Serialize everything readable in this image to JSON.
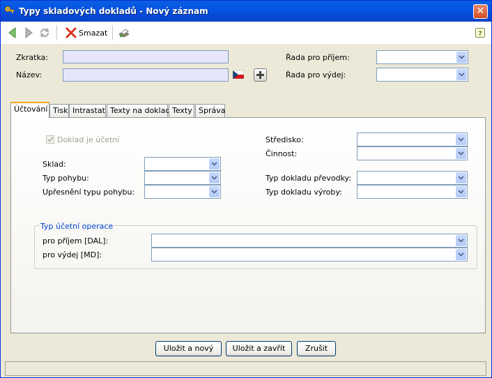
{
  "window": {
    "title": "Typy skladových dokladů - Nový záznam",
    "close": "✕"
  },
  "toolbar": {
    "delete_label": "Smazat"
  },
  "header": {
    "zkratka_label": "Zkratka:",
    "nazev_label": "Název:",
    "rada_prijem_label": "Řada pro příjem:",
    "rada_vydej_label": "Řada pro výdej:"
  },
  "tabs": [
    {
      "label": "Účtování"
    },
    {
      "label": "Tisk"
    },
    {
      "label": "Intrastat"
    },
    {
      "label": "Texty na doklad"
    },
    {
      "label": "Texty"
    },
    {
      "label": "Správa"
    }
  ],
  "accounting": {
    "doklad_ucetni_label": "Doklad je účetní",
    "sklad_label": "Sklad:",
    "typ_pohybu_label": "Typ pohybu:",
    "upresneni_label": "Upřesnění typu pohybu:",
    "stredisko_label": "Středisko:",
    "cinnost_label": "Činnost:",
    "typ_prevodky_label": "Typ dokladu převodky:",
    "typ_vyroby_label": "Typ dokladu výroby:",
    "group_title": "Typ účetní operace",
    "prijem_label": "pro příjem [DAL]:",
    "vydej_label": "pro výdej [MD]:"
  },
  "buttons": {
    "save_new": "Uložit a nový",
    "save_close": "Uložit a zavřít",
    "cancel": "Zrušit"
  },
  "colors": {
    "titlebar": "#0554e3",
    "highlight_input": "#e6e6fa",
    "group_title": "#0046d5"
  }
}
